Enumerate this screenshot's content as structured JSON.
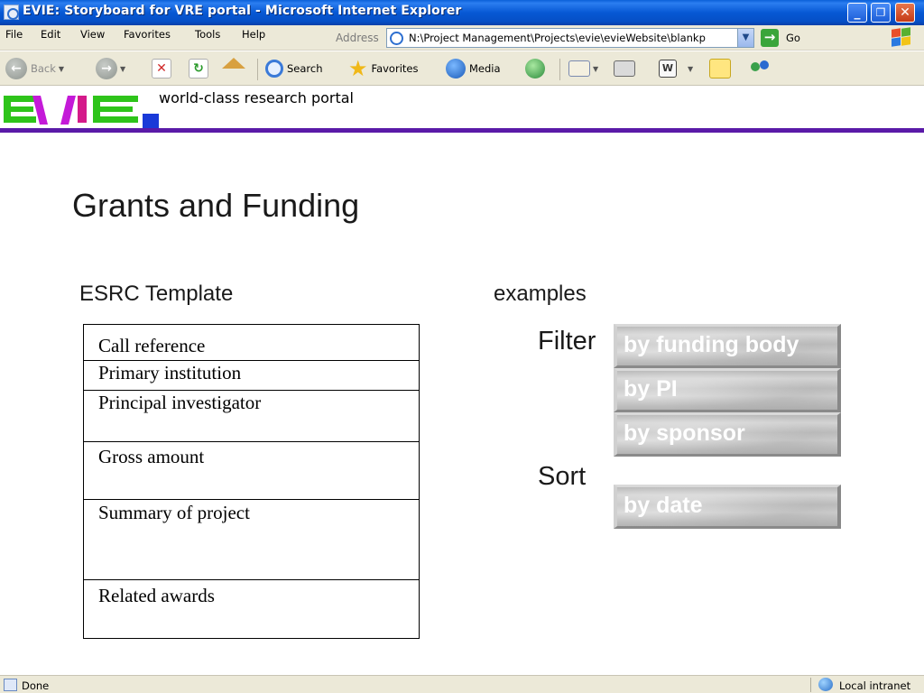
{
  "window": {
    "title": "EVIE: Storyboard for VRE portal - Microsoft Internet Explorer",
    "minimize_glyph": "_",
    "restore_glyph": "❐",
    "close_glyph": "✕"
  },
  "menu": {
    "items": [
      "File",
      "Edit",
      "View",
      "Favorites",
      "Tools",
      "Help"
    ]
  },
  "address": {
    "label": "Address",
    "value": "N:\\Project Management\\Projects\\evie\\evieWebsite\\blankp",
    "go_label": "Go"
  },
  "toolbar": {
    "back_label": "Back",
    "search_label": "Search",
    "favorites_label": "Favorites",
    "media_label": "Media"
  },
  "banner": {
    "logo_text": "EVIE",
    "tagline": "world-class research portal",
    "accent_color": "#5a1aa8"
  },
  "content": {
    "title": "Grants and Funding",
    "template_heading": "ESRC Template",
    "examples_heading": "examples",
    "template_rows": [
      "Call reference",
      "Primary institution",
      "Principal investigator",
      "Gross amount",
      "Summary of project",
      "Related awards"
    ],
    "filter_label": "Filter",
    "filter_buttons": [
      "by funding body",
      "by PI",
      "by sponsor"
    ],
    "sort_label": "Sort",
    "sort_buttons": [
      "by date"
    ]
  },
  "status": {
    "text": "Done",
    "zone": "Local intranet"
  }
}
